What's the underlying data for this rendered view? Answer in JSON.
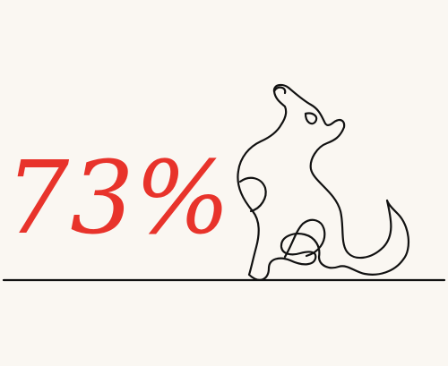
{
  "stat": {
    "value": "73%",
    "color": "#e8332b"
  },
  "illustration": {
    "subject": "howling-dog-line-art",
    "stroke_color": "#111111",
    "background": "#faf7f2"
  }
}
